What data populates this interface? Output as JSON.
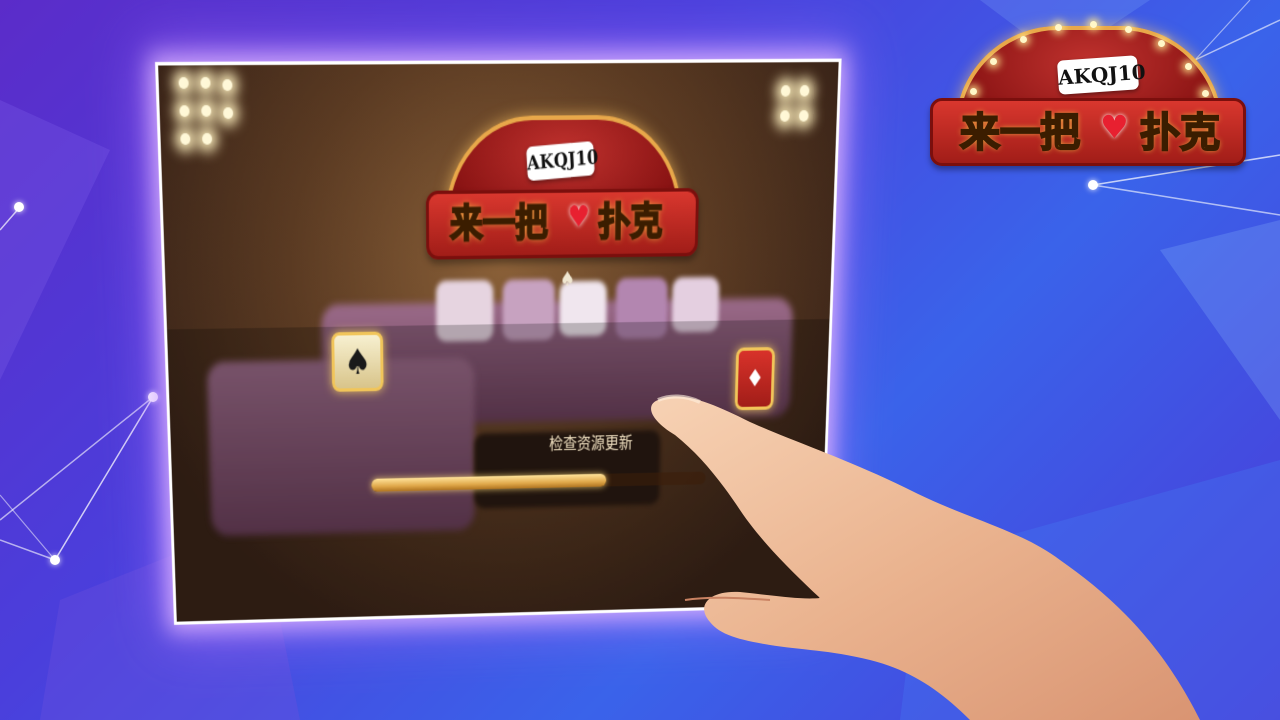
{
  "logo": {
    "cards_text": "AKQJ10",
    "title_left": "来一把",
    "title_right": "扑克"
  },
  "screen": {
    "status_text": "检查资源更新",
    "progress": 0.7,
    "left_suit_icon": "spade-icon",
    "right_suit_icon": "diamond-card-icon",
    "small_icon": "spade-icon"
  },
  "colors": {
    "background_primary": "#4a3fdc",
    "background_secondary": "#5b2cc9",
    "logo_red": "#c0322e",
    "logo_yellow": "#fff23a",
    "progress_gold": "#e0a84a"
  }
}
